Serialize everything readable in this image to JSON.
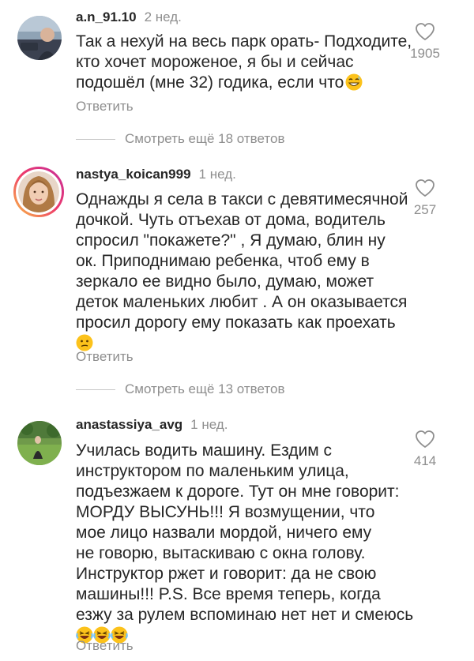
{
  "comments": [
    {
      "username": "a.n_91.10",
      "time": "2 нед.",
      "text": "Так а нехуй на весь парк орать- Подходите,\nкто хочет мороженое, я бы и сейчас\nподошёл (мне 32) годика, если что",
      "emoji": [
        "grinning-sweat"
      ],
      "likes": "1905",
      "reply_label": "Ответить"
    },
    {
      "username": "nastya_koican999",
      "time": "1 нед.",
      "text": "Однажды я села в такси с девятимесячной\nдочкой. Чуть отъехав от дома, водитель\nспросил \"покажете?\" , Я думаю, блин ну\nок. Приподнимаю ребенка, чтоб ему в\nзеркало ее видно было, думаю, может\nдеток маленьких любит . А он оказывается\nпросил дорогу ему показать как проехать",
      "emoji": [
        "confused-face"
      ],
      "likes": "257",
      "reply_label": "Ответить"
    },
    {
      "username": "anastassiya_avg",
      "time": "1 нед.",
      "text": "Училась водить машину. Ездим с\nинструктором по маленьким улица,\nподъезжаем к дороге. Тут он мне говорит:\nМОРДУ ВЫСУНЬ!!! Я возмущении, что\nмое лицо назвали мордой, ничего ему\nне говорю, вытаскиваю с окна голову.\nИнструктор ржет и говорит: да не свою\nмашины!!! P.S. Все время теперь, когда\nезжу за рулем вспоминаю нет нет и смеюсь",
      "emoji": [
        "rofl",
        "rofl",
        "rofl"
      ],
      "likes": "414",
      "reply_label": "Ответить"
    }
  ],
  "more_replies": [
    {
      "label": "Смотреть ещё 18 ответов"
    },
    {
      "label": "Смотреть ещё 13 ответов"
    }
  ],
  "colors": {
    "text": "#262626",
    "secondary": "#8e8e8e",
    "divider": "#c7c7c7",
    "emoji": "#fcc21b"
  }
}
